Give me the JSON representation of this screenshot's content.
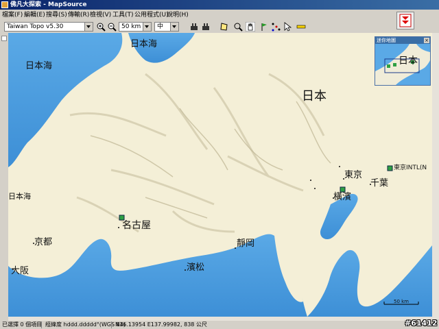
{
  "window": {
    "title": "佛凡大探索 - MapSource"
  },
  "menu": [
    "檔案(F)",
    "編輯(E)",
    "搜尋(S)",
    "傳輸(R)",
    "檢視(V)",
    "工具(T)",
    "公用程式(U)",
    "說明(H)"
  ],
  "toolbar": {
    "product": "Taiwan Topo v5.30",
    "zoom": "50 km",
    "detail": "中"
  },
  "map": {
    "labels": {
      "nihonkai_top": "日本海",
      "nihonkai_left": "日本海",
      "nihonkai_mid": "日本海",
      "nihon": "日本",
      "tokyo": "東京",
      "chiba": "千葉",
      "yokohama": "橫濱",
      "nagoya": "名古屋",
      "kyoto": "京都",
      "osaka": "大阪",
      "shizuoka": "靜岡",
      "hamamatsu": "濱松",
      "tokyo_intl": "東京INTL(N"
    },
    "scale": "50 km",
    "colors": {
      "land": "#f4efd7",
      "sea": "#5aa9e6",
      "relief": "#c9c2a5"
    }
  },
  "minimap": {
    "title": "迷你地圖",
    "label": "日本"
  },
  "status": {
    "selection": "已選擇 0 個項目",
    "format": "經緯度 hddd.ddddd°(WGS 84)",
    "position": "N36.13954 E137.99982, 838 公尺"
  },
  "watermark": "#61412"
}
